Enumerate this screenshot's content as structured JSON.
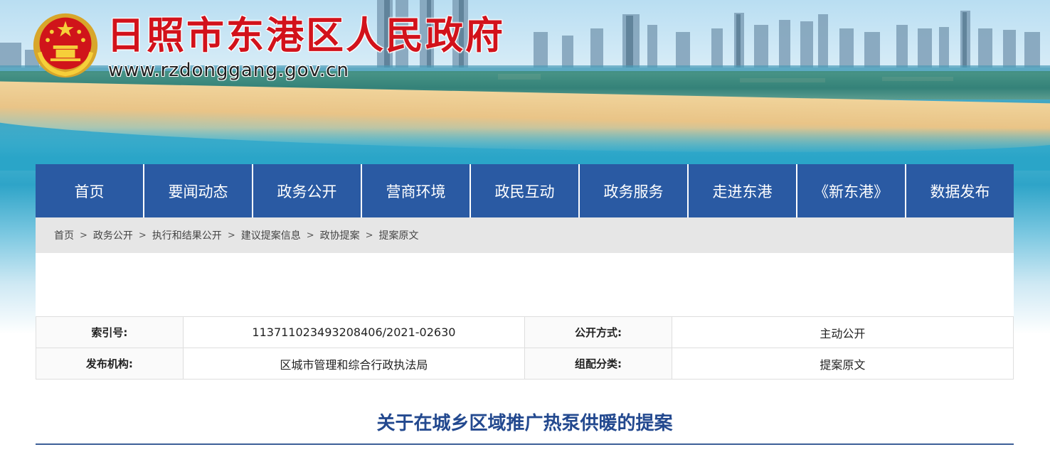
{
  "header": {
    "site_title": "日照市东港区人民政府",
    "site_url": "www.rzdonggang.gov.cn",
    "emblem_icon": "national-emblem-icon"
  },
  "nav": {
    "items": [
      {
        "label": "首页"
      },
      {
        "label": "要闻动态"
      },
      {
        "label": "政务公开"
      },
      {
        "label": "营商环境"
      },
      {
        "label": "政民互动"
      },
      {
        "label": "政务服务"
      },
      {
        "label": "走进东港"
      },
      {
        "label": "《新东港》"
      },
      {
        "label": "数据发布"
      }
    ]
  },
  "breadcrumb": {
    "items": [
      "首页",
      "政务公开",
      "执行和结果公开",
      "建议提案信息",
      "政协提案",
      "提案原文"
    ],
    "separator": ">"
  },
  "info": {
    "index_label": "索引号:",
    "index_value": "11371102349320840​6/2021-02630",
    "open_mode_label": "公开方式:",
    "open_mode_value": "主动公开",
    "publisher_label": "发布机构:",
    "publisher_value": "区城市管理和综合行政执法局",
    "category_label": "组配分类:",
    "category_value": "提案原文"
  },
  "article": {
    "title": "关于在城乡区域推广热泵供暖的提案"
  },
  "colors": {
    "nav_bg": "#2a5aa3",
    "title_red": "#d2121b",
    "article_title": "#23498f",
    "breadcrumb_bg": "#e6e6e6"
  }
}
